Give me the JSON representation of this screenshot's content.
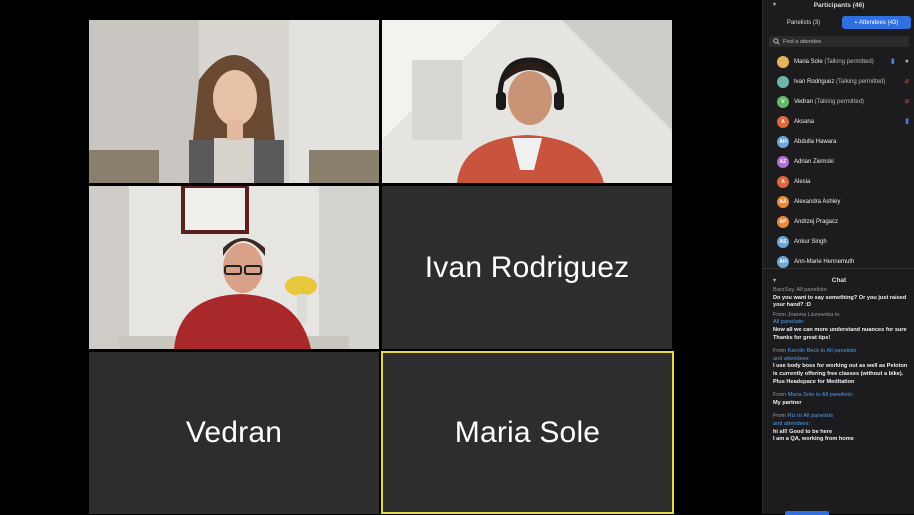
{
  "tiles": {
    "t2_name": "Ivan Rodriguez",
    "t3_name": "Vedran",
    "t4_name": "Maria Sole"
  },
  "participants": {
    "title": "Participants (46)",
    "tab_panelists": "Panelists (3)",
    "tab_attendees": "Attendees (43)",
    "search_placeholder": "Find a attendee",
    "list": [
      {
        "initials": "",
        "name": "Maria Sole",
        "sub": "(Talking permitted)",
        "color": "#e8b25a"
      },
      {
        "initials": "",
        "name": "Ivan Rodriguez",
        "sub": "(Talking permitted)",
        "color": "#6fb6a8"
      },
      {
        "initials": "V",
        "name": "Vedran",
        "sub": "(Talking permitted)",
        "color": "#66b86a"
      },
      {
        "initials": "A",
        "name": "Aksana",
        "sub": "",
        "color": "#e0683f"
      },
      {
        "initials": "AH",
        "name": "Abdulla Hawara",
        "sub": "",
        "color": "#6aa7d8"
      },
      {
        "initials": "AZ",
        "name": "Adrian Ziemski",
        "sub": "",
        "color": "#b06fd0"
      },
      {
        "initials": "A",
        "name": "Alesia",
        "sub": "",
        "color": "#e0683f"
      },
      {
        "initials": "AA",
        "name": "Alexandra Ashley",
        "sub": "",
        "color": "#e98a3a"
      },
      {
        "initials": "AP",
        "name": "Andrzej Pragacz",
        "sub": "",
        "color": "#e98a3a"
      },
      {
        "initials": "AS",
        "name": "Ankur Singh",
        "sub": "",
        "color": "#6aa7d8"
      },
      {
        "initials": "AH",
        "name": "Ann-Marie Hennemuth",
        "sub": "",
        "color": "#6aa7d8"
      }
    ]
  },
  "chat": {
    "title": "Chat",
    "messages": [
      {
        "meta_from": "",
        "from": "",
        "to": "",
        "to2": "",
        "text1": "BarzSay, All panelists:",
        "text2": ""
      },
      {
        "meta_from": "",
        "from": "",
        "to": "",
        "to2": "",
        "text1": "Do you want to say something? Or you just raised your hand? :D",
        "text2": ""
      },
      {
        "meta_from": "From Joanna Liszewska to",
        "from": "",
        "to": "All panelists:",
        "to2": "",
        "text1": "Now all we can more understand nuances for sure",
        "text2": "Thanks for great tips!"
      },
      {
        "meta_from": "From",
        "from": "Karolin Beck",
        "to": "to All panelists",
        "to2": "and attendees:",
        "text1": "I use body boss for working out as well as Peloton is currently offering free classes (without a bike). Plus Headspace for Meditation",
        "text2": ""
      },
      {
        "meta_from": "From",
        "from": "Maria Sole",
        "to": "to All panelists:",
        "to2": "",
        "text1": "My partner",
        "text2": ""
      },
      {
        "meta_from": "From",
        "from": "Riz",
        "to": "to All panelists",
        "to2": "and attendees:",
        "text1": "hi all! Good to be here",
        "text2": "I am a QA, working from home"
      }
    ]
  }
}
